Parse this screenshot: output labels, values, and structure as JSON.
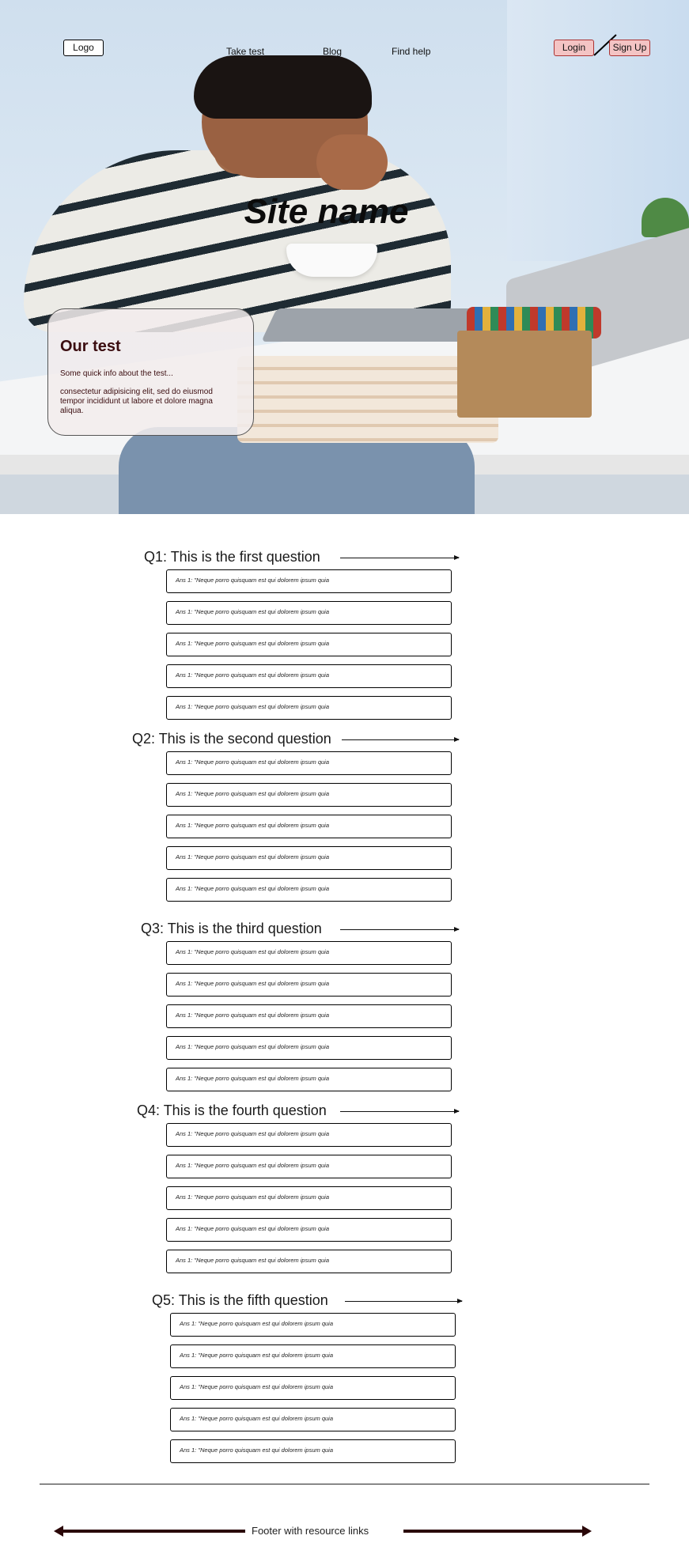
{
  "nav": {
    "logo": "Logo",
    "links": [
      "Take test",
      "Blog",
      "Find help"
    ],
    "login": "Login",
    "signup": "Sign Up"
  },
  "hero": {
    "site_name": "Site name",
    "card": {
      "title": "Our test",
      "subtitle": "Some quick info about the test...",
      "body": " consectetur adipisicing elit, sed do eiusmod tempor incididunt ut labore et dolore magna aliqua."
    }
  },
  "questions": [
    {
      "title": "Q1: This is the first question",
      "answers": [
        "Ans 1: \"Neque porro quisquam est qui dolorem ipsum quia",
        "Ans 1: \"Neque porro quisquam est qui dolorem ipsum quia",
        "Ans 1: \"Neque porro quisquam est qui dolorem ipsum quia",
        "Ans 1: \"Neque porro quisquam est qui dolorem ipsum quia",
        "Ans 1: \"Neque porro quisquam est qui dolorem ipsum quia"
      ]
    },
    {
      "title": "Q2: This is the second question",
      "answers": [
        "Ans 1: \"Neque porro quisquam est qui dolorem ipsum quia",
        "Ans 1: \"Neque porro quisquam est qui dolorem ipsum quia",
        "Ans 1: \"Neque porro quisquam est qui dolorem ipsum quia",
        "Ans 1: \"Neque porro quisquam est qui dolorem ipsum quia",
        "Ans 1: \"Neque porro quisquam est qui dolorem ipsum quia"
      ]
    },
    {
      "title": "Q3: This is the third question",
      "answers": [
        "Ans 1: \"Neque porro quisquam est qui dolorem ipsum quia",
        "Ans 1: \"Neque porro quisquam est qui dolorem ipsum quia",
        "Ans 1: \"Neque porro quisquam est qui dolorem ipsum quia",
        "Ans 1: \"Neque porro quisquam est qui dolorem ipsum quia",
        "Ans 1: \"Neque porro quisquam est qui dolorem ipsum quia"
      ]
    },
    {
      "title": "Q4: This is the fourth question",
      "answers": [
        "Ans 1: \"Neque porro quisquam est qui dolorem ipsum quia",
        "Ans 1: \"Neque porro quisquam est qui dolorem ipsum quia",
        "Ans 1: \"Neque porro quisquam est qui dolorem ipsum quia",
        "Ans 1: \"Neque porro quisquam est qui dolorem ipsum quia",
        "Ans 1: \"Neque porro quisquam est qui dolorem ipsum quia"
      ]
    },
    {
      "title": "Q5: This is the fifth question",
      "answers": [
        "Ans 1: \"Neque porro quisquam est qui dolorem ipsum quia",
        "Ans 1: \"Neque porro quisquam est qui dolorem ipsum quia",
        "Ans 1: \"Neque porro quisquam est qui dolorem ipsum quia",
        "Ans 1: \"Neque porro quisquam est qui dolorem ipsum quia",
        "Ans 1: \"Neque porro quisquam est qui dolorem ipsum quia"
      ]
    }
  ],
  "footer": {
    "text": "Footer with resource links"
  }
}
